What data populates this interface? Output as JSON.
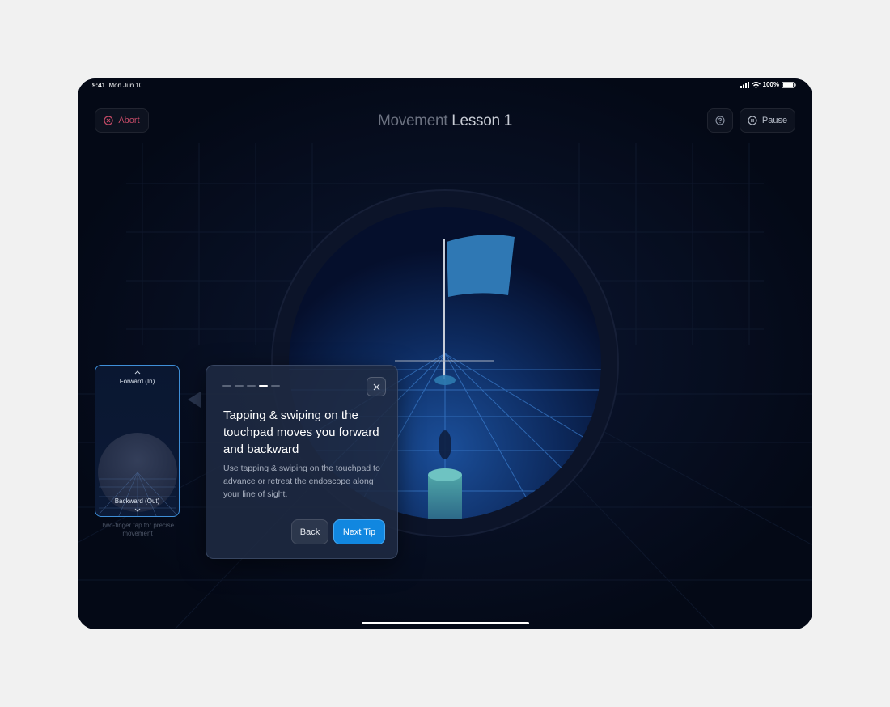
{
  "status": {
    "time": "9:41",
    "date": "Mon Jun 10",
    "battery": "100%"
  },
  "header": {
    "abort_label": "Abort",
    "title_light": "Movement",
    "title_bold": "Lesson 1",
    "pause_label": "Pause"
  },
  "touchpad": {
    "forward_label": "Forward (In)",
    "backward_label": "Backward (Out)",
    "caption": "Two-finger tap for precise movement"
  },
  "tip": {
    "steps_total": 5,
    "current_step": 4,
    "heading": "Tapping & swiping on the touchpad  moves you forward and backward",
    "body": "Use tapping & swiping on the touchpad to advance or retreat the endoscope along your line of sight.",
    "back_label": "Back",
    "next_label": "Next Tip"
  },
  "colors": {
    "accent": "#1187e0",
    "abort": "#c24a66",
    "background": "#050b1c",
    "flag": "#2f78b4"
  },
  "icons": {
    "abort": "x-circle-icon",
    "help": "question-circle-icon",
    "pause": "pause-circle-icon",
    "close": "close-icon"
  }
}
